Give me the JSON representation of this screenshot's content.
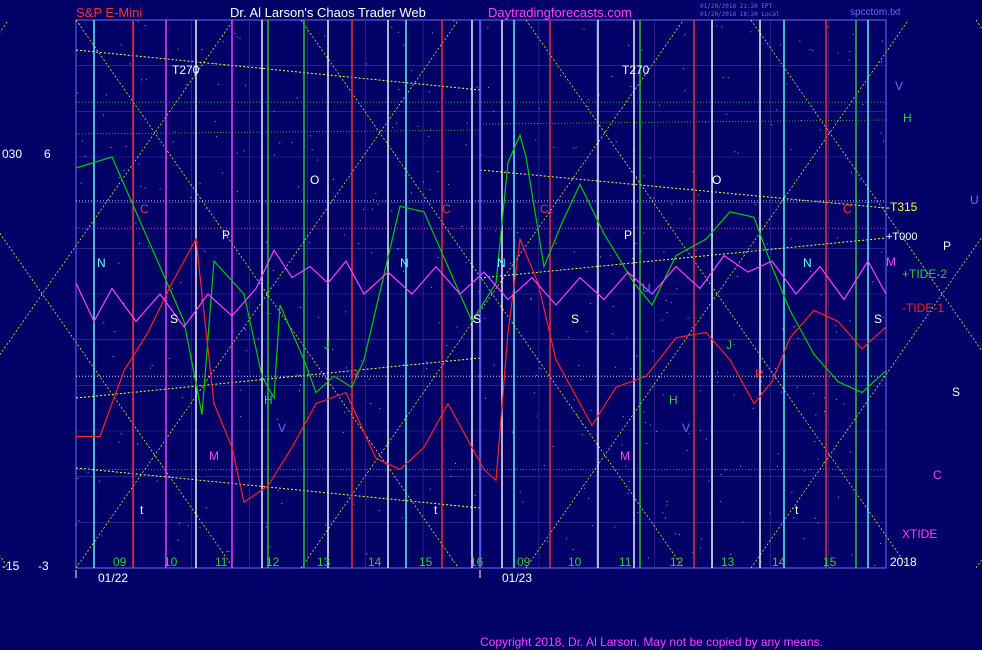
{
  "header": {
    "symbol": "S&P E-Mini",
    "site": "Dr. Al Larson's Chaos Trader Web",
    "url": "Daytradingforecasts.com",
    "timestamp_1": "01/20/2018 21:20 EPT",
    "timestamp_2": "01/20/2018 18:20 Local",
    "file": "spcctom.txt"
  },
  "footer": {
    "copyright": "Copyright 2018, Dr. Al Larson. May not be copied by any means."
  },
  "axis": {
    "left_top_outer": "030",
    "left_top_inner": "6",
    "left_bottom_outer": "-15",
    "left_bottom_inner": "-3",
    "year": "2018",
    "hours_day1": [
      "09",
      "10",
      "11",
      "12",
      "13",
      "14",
      "15",
      "16"
    ],
    "hours_day2": [
      "09",
      "10",
      "11",
      "12",
      "13",
      "14",
      "15"
    ],
    "dates": [
      "01/22",
      "01/23"
    ]
  },
  "right_labels": {
    "V": "V",
    "H": "H",
    "T315": "-T315",
    "U": "U",
    "T000": "+T000",
    "P": "P",
    "M": "M",
    "TIDE2": "+TIDE-2",
    "TIDE1": "-TIDE-1",
    "S": "S",
    "C": "C",
    "XTIDE": "XTIDE"
  },
  "markers": {
    "T270": "T270",
    "N": "N",
    "S": "S",
    "P": "P",
    "O": "O",
    "C": "C",
    "J": "J",
    "R": "R",
    "H": "H",
    "V": "V",
    "M": "M",
    "t": "t",
    "U": "U"
  },
  "colors": {
    "background": "#000066",
    "frame": "#6b6bff",
    "grid": "#3a3aa8",
    "price": "#00cc00",
    "tide": "#ff2020",
    "xtide": "#ff40ff",
    "shadow": "#ffff33",
    "white_line": "#ffffff",
    "cyan_line": "#66ffff",
    "red_line": "#ff3030",
    "green_line": "#33cc33",
    "magenta_line": "#ff44ff"
  },
  "chart_data": {
    "type": "line",
    "title": "S&P E-Mini",
    "x_axis": "intraday hours, 01/22 09:00 to 01/23 15:30",
    "y_range_outer": [
      -15,
      30
    ],
    "y_range_inner": [
      -3,
      6
    ],
    "series": [
      {
        "name": "",
        "color": "#00cc00",
        "points": [
          [
            0,
            0.73
          ],
          [
            0.6,
            0.75
          ],
          [
            1.2,
            0.6
          ],
          [
            1.8,
            0.45
          ],
          [
            2.1,
            0.28
          ],
          [
            2.3,
            0.56
          ],
          [
            2.8,
            0.5
          ],
          [
            3.1,
            0.35
          ],
          [
            3.3,
            0.31
          ],
          [
            3.4,
            0.48
          ],
          [
            3.8,
            0.38
          ],
          [
            4.0,
            0.32
          ],
          [
            4.3,
            0.35
          ],
          [
            4.6,
            0.33
          ],
          [
            4.8,
            0.38
          ],
          [
            5.4,
            0.66
          ],
          [
            5.8,
            0.65
          ],
          [
            6.2,
            0.55
          ],
          [
            6.6,
            0.45
          ],
          [
            7.0,
            0.52
          ],
          [
            7.2,
            0.74
          ],
          [
            7.4,
            0.79
          ],
          [
            7.5,
            0.75
          ],
          [
            7.8,
            0.55
          ],
          [
            8.1,
            0.63
          ],
          [
            8.4,
            0.7
          ],
          [
            8.8,
            0.61
          ],
          [
            9.3,
            0.52
          ],
          [
            9.6,
            0.48
          ],
          [
            10.0,
            0.57
          ],
          [
            10.5,
            0.6
          ],
          [
            10.9,
            0.65
          ],
          [
            11.3,
            0.64
          ],
          [
            11.6,
            0.55
          ],
          [
            11.9,
            0.47
          ],
          [
            12.3,
            0.39
          ],
          [
            12.7,
            0.34
          ],
          [
            13.1,
            0.32
          ],
          [
            13.5,
            0.36
          ]
        ]
      },
      {
        "name": "-TIDE-1",
        "color": "#ff2020",
        "points": [
          [
            0,
            0.24
          ],
          [
            0.4,
            0.24
          ],
          [
            0.8,
            0.36
          ],
          [
            1.2,
            0.43
          ],
          [
            1.6,
            0.52
          ],
          [
            2.0,
            0.6
          ],
          [
            2.3,
            0.3
          ],
          [
            2.6,
            0.22
          ],
          [
            2.8,
            0.12
          ],
          [
            3.2,
            0.15
          ],
          [
            3.6,
            0.22
          ],
          [
            4.0,
            0.3
          ],
          [
            4.5,
            0.32
          ],
          [
            5.0,
            0.2
          ],
          [
            5.4,
            0.18
          ],
          [
            5.8,
            0.22
          ],
          [
            6.2,
            0.3
          ],
          [
            6.8,
            0.18
          ],
          [
            7.0,
            0.16
          ],
          [
            7.2,
            0.43
          ],
          [
            7.4,
            0.6
          ],
          [
            7.7,
            0.52
          ],
          [
            8.0,
            0.38
          ],
          [
            8.3,
            0.32
          ],
          [
            8.6,
            0.26
          ],
          [
            9.0,
            0.33
          ],
          [
            9.5,
            0.35
          ],
          [
            10.0,
            0.42
          ],
          [
            10.5,
            0.43
          ],
          [
            10.9,
            0.38
          ],
          [
            11.3,
            0.3
          ],
          [
            11.6,
            0.34
          ],
          [
            11.9,
            0.42
          ],
          [
            12.3,
            0.47
          ],
          [
            12.7,
            0.45
          ],
          [
            13.1,
            0.4
          ],
          [
            13.5,
            0.44
          ]
        ]
      },
      {
        "name": "XTIDE",
        "color": "#ff40ff",
        "points": [
          [
            0,
            0.52
          ],
          [
            0.3,
            0.45
          ],
          [
            0.6,
            0.51
          ],
          [
            1.0,
            0.45
          ],
          [
            1.4,
            0.5
          ],
          [
            1.8,
            0.44
          ],
          [
            2.2,
            0.5
          ],
          [
            2.6,
            0.46
          ],
          [
            3.0,
            0.51
          ],
          [
            3.3,
            0.58
          ],
          [
            3.6,
            0.53
          ],
          [
            3.9,
            0.55
          ],
          [
            4.2,
            0.52
          ],
          [
            4.5,
            0.56
          ],
          [
            4.8,
            0.5
          ],
          [
            5.2,
            0.54
          ],
          [
            5.6,
            0.5
          ],
          [
            6.0,
            0.55
          ],
          [
            6.4,
            0.5
          ],
          [
            6.8,
            0.54
          ],
          [
            7.2,
            0.49
          ],
          [
            7.6,
            0.53
          ],
          [
            8.0,
            0.48
          ],
          [
            8.4,
            0.53
          ],
          [
            8.8,
            0.49
          ],
          [
            9.2,
            0.54
          ],
          [
            9.6,
            0.5
          ],
          [
            10.0,
            0.55
          ],
          [
            10.4,
            0.51
          ],
          [
            10.8,
            0.57
          ],
          [
            11.2,
            0.54
          ],
          [
            11.6,
            0.56
          ],
          [
            12.0,
            0.5
          ],
          [
            12.4,
            0.55
          ],
          [
            12.8,
            0.49
          ],
          [
            13.2,
            0.56
          ],
          [
            13.5,
            0.5
          ]
        ]
      }
    ],
    "vertical_lines": [
      {
        "x": 0.3,
        "color": "cyan"
      },
      {
        "x": 0.95,
        "color": "red"
      },
      {
        "x": 1.5,
        "color": "magenta"
      },
      {
        "x": 2.0,
        "color": "white"
      },
      {
        "x": 2.6,
        "color": "magenta"
      },
      {
        "x": 3.1,
        "color": "white"
      },
      {
        "x": 3.2,
        "color": "green"
      },
      {
        "x": 3.8,
        "color": "green"
      },
      {
        "x": 4.2,
        "color": "white"
      },
      {
        "x": 4.6,
        "color": "red"
      },
      {
        "x": 5.2,
        "color": "white"
      },
      {
        "x": 5.5,
        "color": "cyan"
      },
      {
        "x": 6.1,
        "color": "red"
      },
      {
        "x": 6.6,
        "color": "white"
      },
      {
        "x": 7.1,
        "color": "white"
      },
      {
        "x": 7.3,
        "color": "cyan"
      },
      {
        "x": 7.9,
        "color": "red"
      },
      {
        "x": 8.7,
        "color": "white"
      },
      {
        "x": 9.3,
        "color": "white"
      },
      {
        "x": 9.4,
        "color": "green"
      },
      {
        "x": 10.3,
        "color": "red"
      },
      {
        "x": 10.6,
        "color": "white"
      },
      {
        "x": 11.4,
        "color": "white"
      },
      {
        "x": 11.8,
        "color": "cyan"
      },
      {
        "x": 12.5,
        "color": "red"
      },
      {
        "x": 13.0,
        "color": "green"
      },
      {
        "x": 13.2,
        "color": "cyan"
      }
    ],
    "horizontal_lines": [
      {
        "y": 0.62,
        "color": "magenta",
        "label": "M"
      },
      {
        "y": 0.67,
        "color": "white",
        "label": "+T000"
      },
      {
        "y": 0.85,
        "color": "green",
        "label": "H"
      },
      {
        "y": 0.35,
        "color": "white",
        "label": "S"
      },
      {
        "y": 0.18,
        "color": "magenta",
        "label": "C"
      }
    ]
  }
}
